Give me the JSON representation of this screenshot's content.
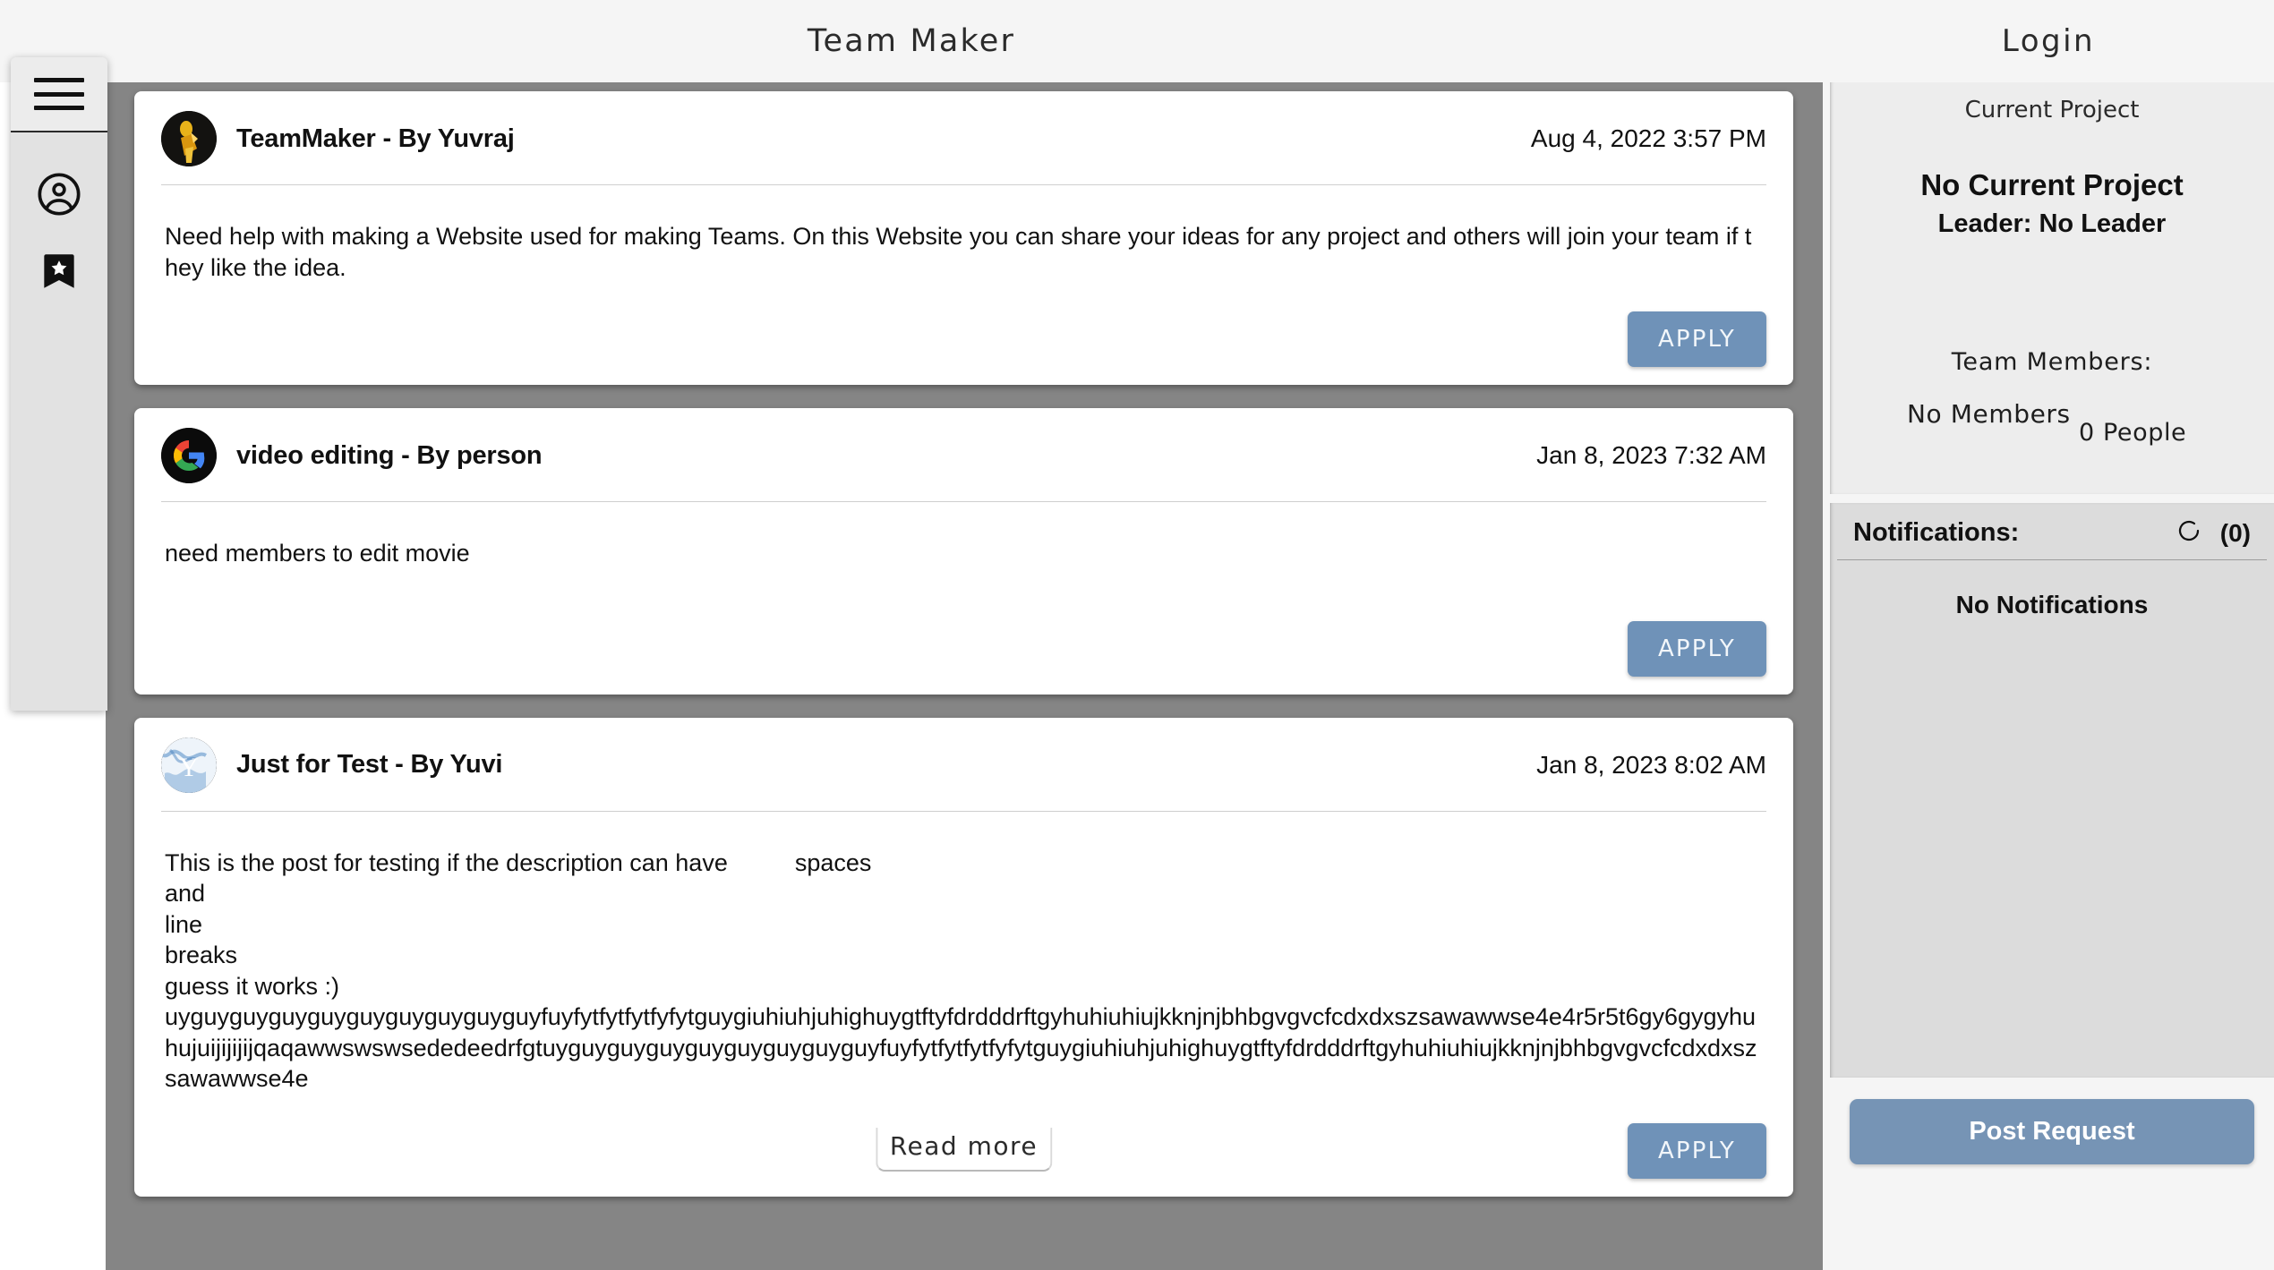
{
  "header": {
    "app_title": "Team Maker",
    "login_label": "Login"
  },
  "sidebar": {
    "menu_icon": "hamburger-menu-icon",
    "items": [
      {
        "icon": "account-circle-icon",
        "name": "account"
      },
      {
        "icon": "bookmark-star-icon",
        "name": "bookmarks"
      }
    ]
  },
  "feed": {
    "posts": [
      {
        "title": "TeamMaker - By Yuvraj",
        "date": "Aug 4, 2022 3:57 PM",
        "avatar": "dark-gold-figure-avatar",
        "body": "Need help with making a Website used for making Teams. On this Website you can share your ideas for any project and others will join your team if they like the idea.",
        "apply_label": "APPLY",
        "read_more_label": "",
        "has_read_more": false
      },
      {
        "title": "video editing - By person",
        "date": "Jan 8, 2023 7:32 AM",
        "avatar": "google-g-avatar",
        "body": "need members to edit movie",
        "apply_label": "APPLY",
        "read_more_label": "",
        "has_read_more": false
      },
      {
        "title": "Just for Test - By Yuvi",
        "date": "Jan 8, 2023 8:02 AM",
        "avatar": "blue-y-avatar",
        "body": "This is the post for testing if the description can have          spaces\nand\nline\nbreaks\nguess it works :)\nuyguyguyguyguyguyguyguyguyguyfuyfytfytfytfyfytguygiuhiuhjuhighuygtftyfdrdddrftgyhuhiuhiujkknjnjbhbgvgvcfcdxdxszsawawwse4e4r5r5t6gy6gygyhuhujuijijijijqaqawwswswsededeedrfgtuyguyguyguyguyguyguyguyguyfuyfytfytfytfyfytguygiuhiuhjuhighuygtftyfdrdddrftgyhuhiuhiujkknjnjbhbgvgvcfcdxdxszsawawwse4e",
        "apply_label": "APPLY",
        "read_more_label": "Read more",
        "has_read_more": true
      }
    ]
  },
  "right_panel": {
    "current_project_label": "Current Project",
    "current_project_name": "No Current Project",
    "leader_text": "Leader: No Leader",
    "team_members_label": "Team Members:",
    "members_empty": "No Members",
    "members_count": "0 People",
    "notifications_title": "Notifications:",
    "notifications_count": "(0)",
    "notifications_refresh_icon": "refresh-icon",
    "notifications_empty": "No Notifications",
    "post_request_label": "Post Request"
  },
  "colors": {
    "accent_button": "#6f92b8",
    "post_request_button": "#7694b5",
    "feed_background": "#858585",
    "panel_background": "#ededed",
    "notifications_background": "#dcdcdc"
  }
}
